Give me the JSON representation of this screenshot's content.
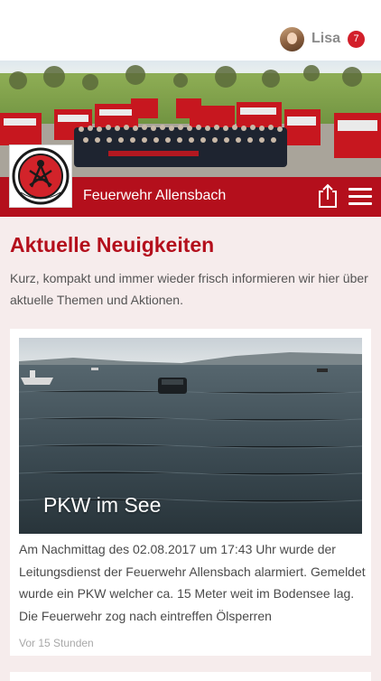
{
  "user": {
    "name": "Lisa",
    "notification_count": "7"
  },
  "header": {
    "org_name": "Feuerwehr Allensbach",
    "logo_text": "ALLENSBACH"
  },
  "section": {
    "title": "Aktuelle Neuigkeiten",
    "intro": "Kurz, kompakt und immer wieder frisch informieren wir hier über aktuelle Themen und Aktionen."
  },
  "news": [
    {
      "title": "PKW im See",
      "text": "Am Nachmittag des 02.08.2017 um 17:43 Uhr wurde der Leitungsdienst der Feuerwehr Allensbach alarmiert. Gemeldet wurde ein PKW welcher ca. 15 Meter weit im Bodensee lag. Die Feuerwehr zog nach eintreffen Ölsperren",
      "time": "Vor 15 Stunden"
    }
  ],
  "colors": {
    "brand_red": "#b40f1c",
    "badge_red": "#d21f2a",
    "page_bg": "#f6ecec"
  },
  "icons": {
    "share": "share-icon",
    "menu": "hamburger-menu-icon"
  }
}
